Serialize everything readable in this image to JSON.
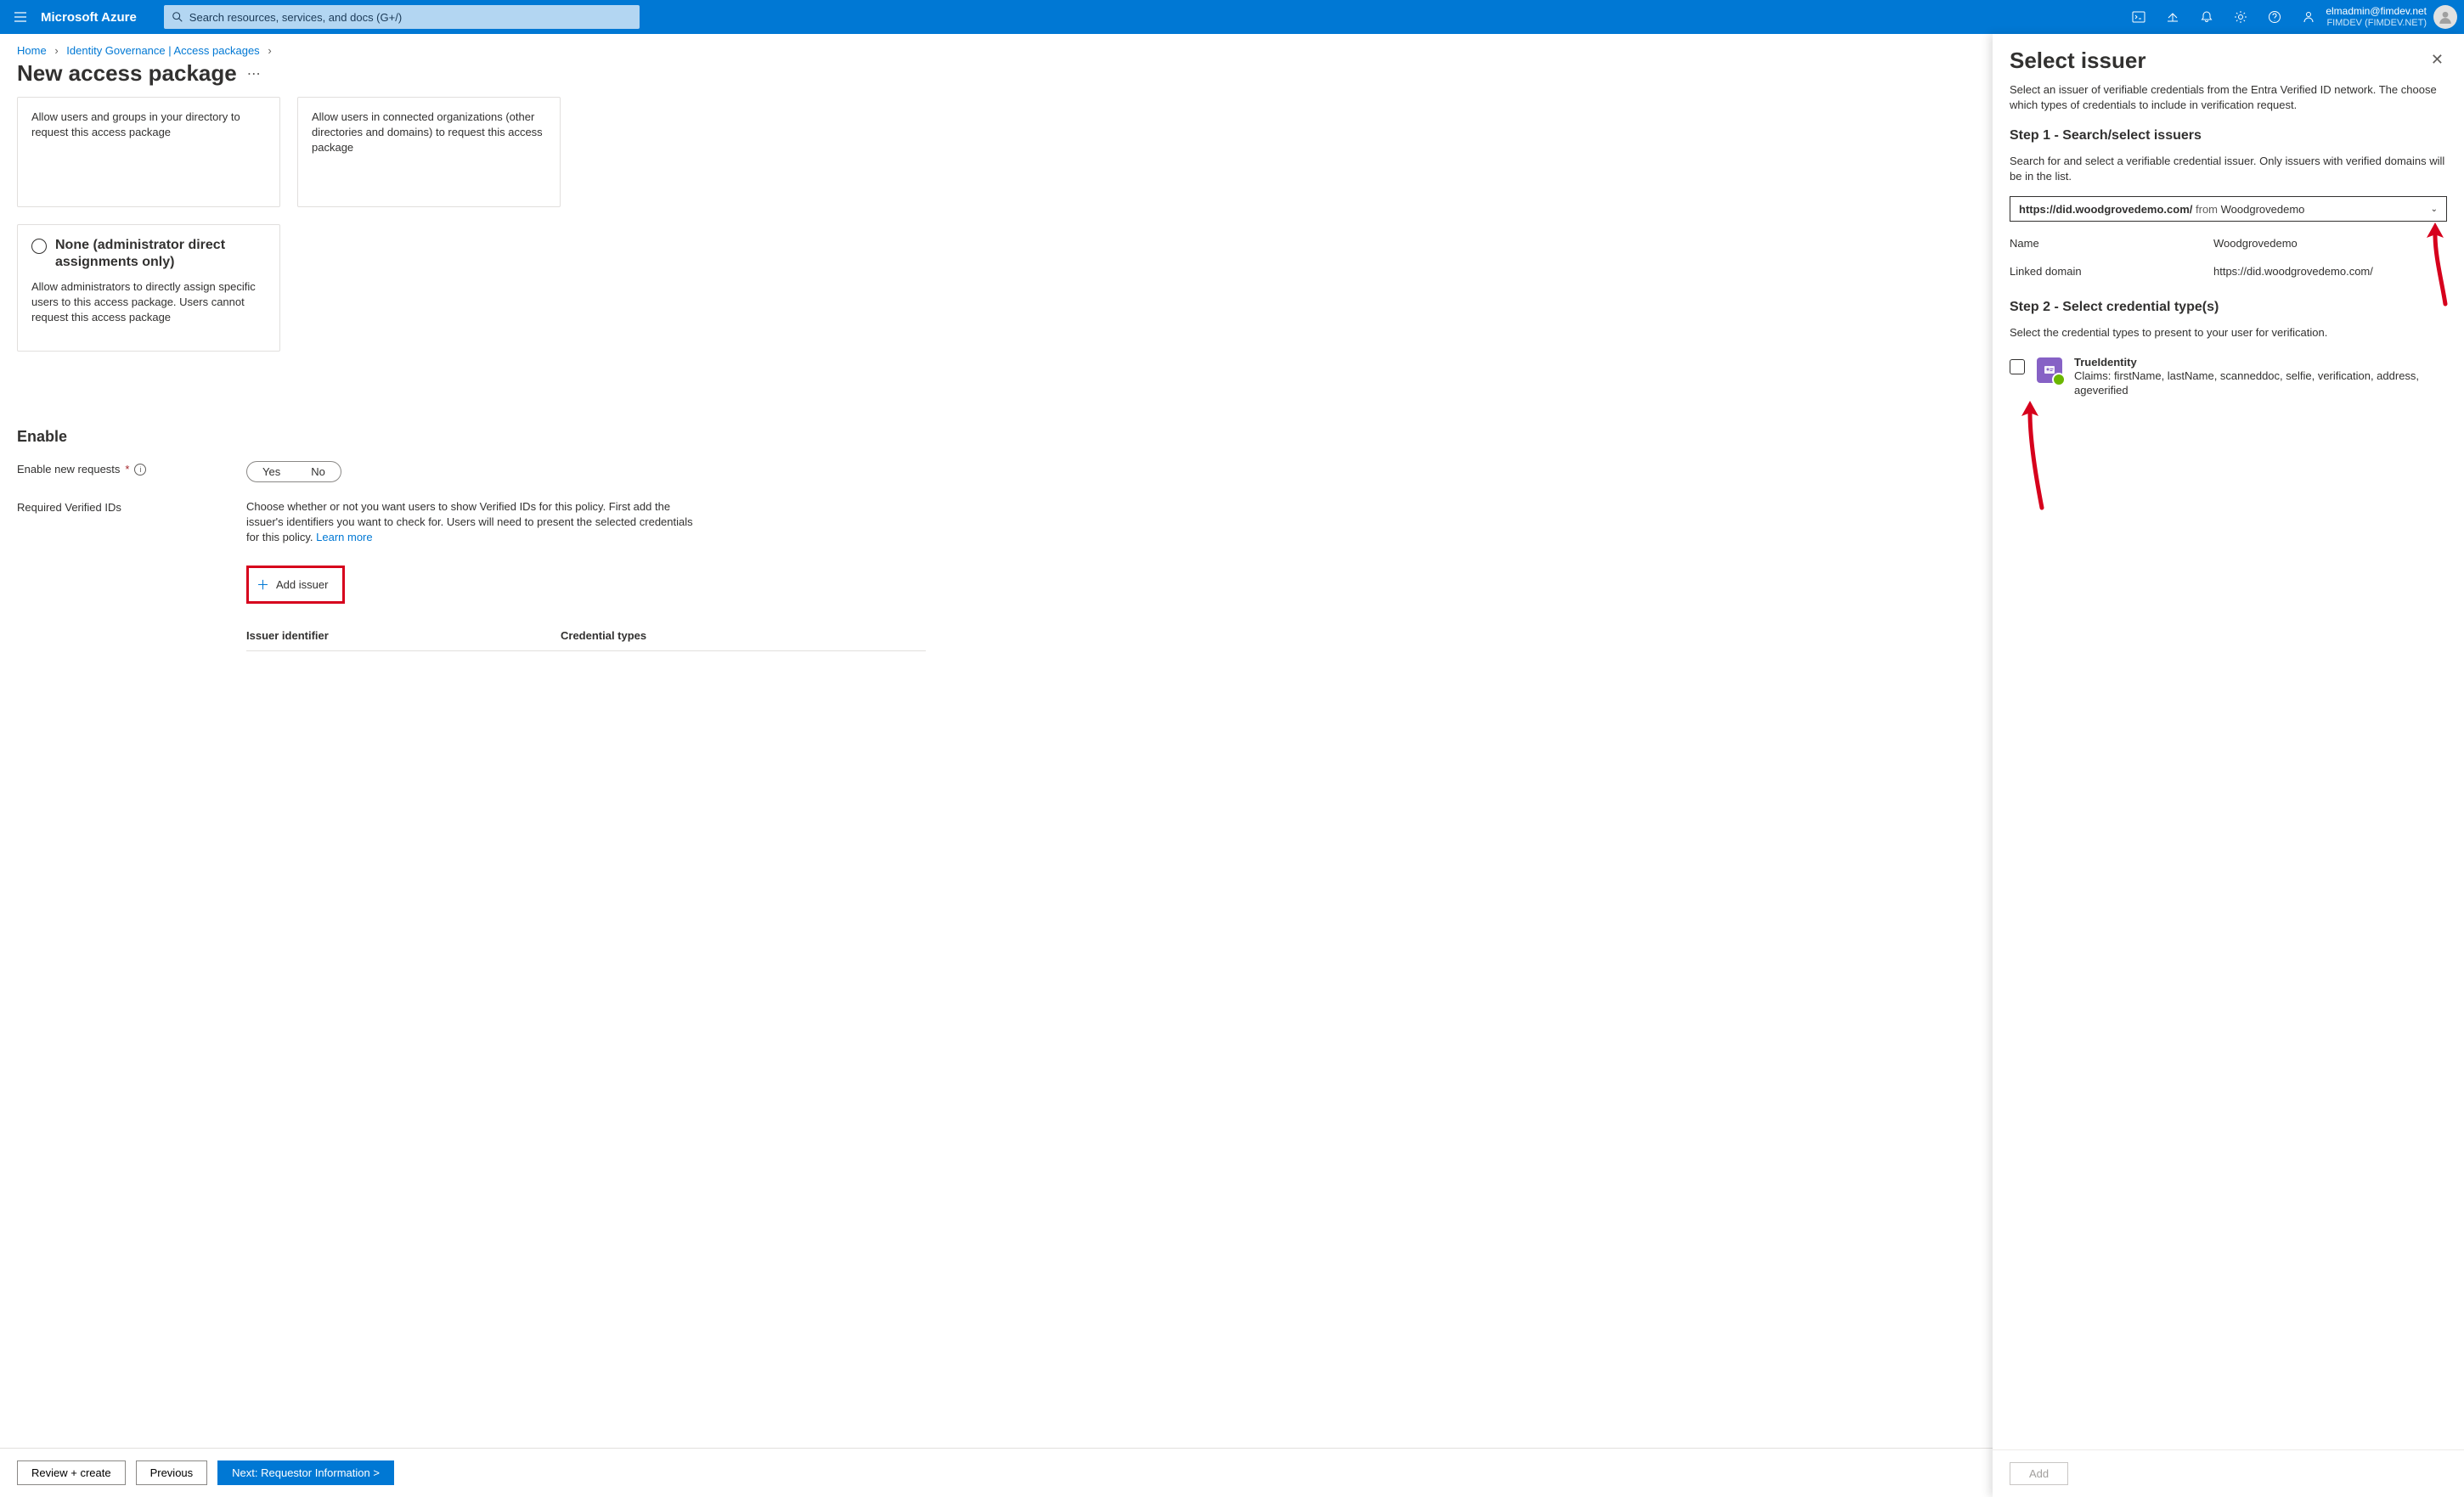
{
  "topbar": {
    "brand": "Microsoft Azure",
    "search_placeholder": "Search resources, services, and docs (G+/)",
    "account": {
      "email": "elmadmin@fimdev.net",
      "tenant": "FIMDEV (FIMDEV.NET)"
    }
  },
  "breadcrumb": {
    "home": "Home",
    "level1": "Identity Governance | Access packages"
  },
  "page": {
    "title": "New access package"
  },
  "cards": {
    "directory_desc": "Allow users and groups in your directory to request this access package",
    "connected_desc": "Allow users in connected organizations (other directories and domains) to request this access package",
    "none_title": "None (administrator direct assignments only)",
    "none_desc": "Allow administrators to directly assign specific users to this access package. Users cannot request this access package"
  },
  "enable": {
    "section_title": "Enable",
    "new_requests_label": "Enable new requests",
    "yes": "Yes",
    "no": "No",
    "verified_ids_label": "Required Verified IDs",
    "verified_ids_desc_pre": "Choose whether or not you want users to show Verified IDs for this policy. First add the issuer's identifiers you want to check for. Users will need to present the selected credentials for this policy. ",
    "learn_more": "Learn more",
    "add_issuer": "Add issuer",
    "th_issuer_id": "Issuer identifier",
    "th_cred_types": "Credential types"
  },
  "footer": {
    "review": "Review + create",
    "previous": "Previous",
    "next": "Next: Requestor Information >"
  },
  "panel": {
    "title": "Select issuer",
    "intro": "Select an issuer of verifiable credentials from the Entra Verified ID network. The choose which types of credentials to include in verification request.",
    "step1_title": "Step 1 - Search/select issuers",
    "step1_sub": "Search for and select a verifiable credential issuer. Only issuers with verified domains will be in the list.",
    "dropdown": {
      "url": "https://did.woodgrovedemo.com/",
      "from": "from",
      "org": "Woodgrovedemo"
    },
    "name_label": "Name",
    "name_value": "Woodgrovedemo",
    "domain_label": "Linked domain",
    "domain_value": "https://did.woodgrovedemo.com/",
    "step2_title": "Step 2 - Select credential type(s)",
    "step2_sub": "Select the credential types to present to your user for verification.",
    "cred": {
      "title": "TrueIdentity",
      "claims": "Claims: firstName, lastName, scanneddoc, selfie, verification, address, ageverified"
    },
    "add_button": "Add"
  }
}
